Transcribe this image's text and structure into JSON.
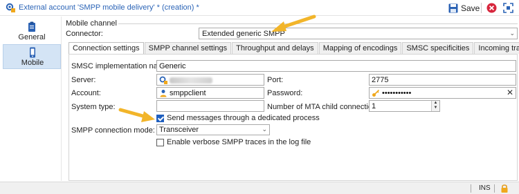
{
  "window": {
    "title": "External account 'SMPP mobile delivery' * (creation) *",
    "save_label": "Save"
  },
  "sidebar": {
    "items": [
      {
        "label": "General",
        "icon": "clipboard-icon",
        "active": false
      },
      {
        "label": "Mobile",
        "icon": "mobile-phone-icon",
        "active": true
      }
    ]
  },
  "section": {
    "title": "Mobile channel"
  },
  "connector": {
    "label": "Connector:",
    "value": "Extended generic SMPP"
  },
  "tabs": [
    {
      "label": "Connection settings",
      "active": true
    },
    {
      "label": "SMPP channel settings",
      "active": false
    },
    {
      "label": "Throughput and delays",
      "active": false
    },
    {
      "label": "Mapping of encodings",
      "active": false
    },
    {
      "label": "SMSC specificities",
      "active": false
    },
    {
      "label": "Incoming traffic",
      "active": false
    }
  ],
  "form": {
    "smsc_label": "SMSC implementation name:",
    "smsc_value": "Generic",
    "server_label": "Server:",
    "port_label": "Port:",
    "port_value": "2775",
    "account_label": "Account:",
    "account_value": "smppclient",
    "password_label": "Password:",
    "password_value": "•••••••••••",
    "system_type_label": "System type:",
    "system_type_value": "",
    "mta_label": "Number of MTA child connections:",
    "mta_value": "1",
    "dedicated_process_label": "Send messages through a dedicated process",
    "dedicated_process_checked": true,
    "mode_label": "SMPP connection mode:",
    "mode_value": "Transceiver",
    "verbose_label": "Enable verbose SMPP traces in the log file",
    "verbose_checked": false
  },
  "status": {
    "mode": "INS"
  },
  "colors": {
    "accent": "#2a63b6",
    "arrow": "#f2b52a",
    "active_tab_bg": "#d4e4f5"
  }
}
